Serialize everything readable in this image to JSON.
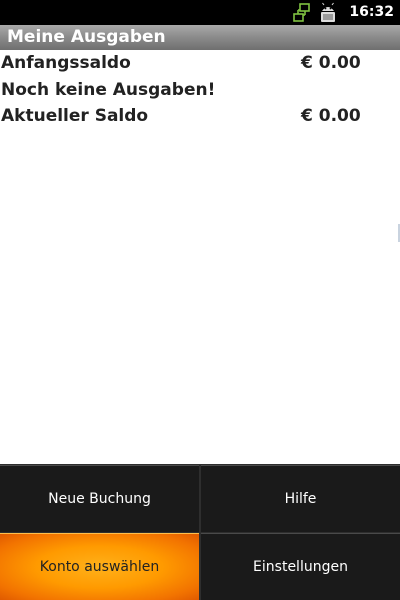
{
  "status_bar": {
    "time": "16:32",
    "icons": [
      "network-sync-icon",
      "android-usb-icon"
    ]
  },
  "title_bar": {
    "title": "Meine Ausgaben"
  },
  "summary": {
    "start_balance_label": "Anfangssaldo",
    "start_balance_value": "€ 0.00",
    "empty_message": "Noch keine Ausgaben!",
    "current_balance_label": "Aktueller Saldo",
    "current_balance_value": "€ 0.00"
  },
  "menu": {
    "items": [
      {
        "label": "Neue Buchung",
        "selected": false
      },
      {
        "label": "Hilfe",
        "selected": false
      },
      {
        "label": "Konto auswählen",
        "selected": true
      },
      {
        "label": "Einstellungen",
        "selected": false
      }
    ]
  },
  "colors": {
    "menu_highlight": "#ff9a00",
    "status_icon_green": "#7fc241",
    "title_bar": "#8a8a8a"
  }
}
